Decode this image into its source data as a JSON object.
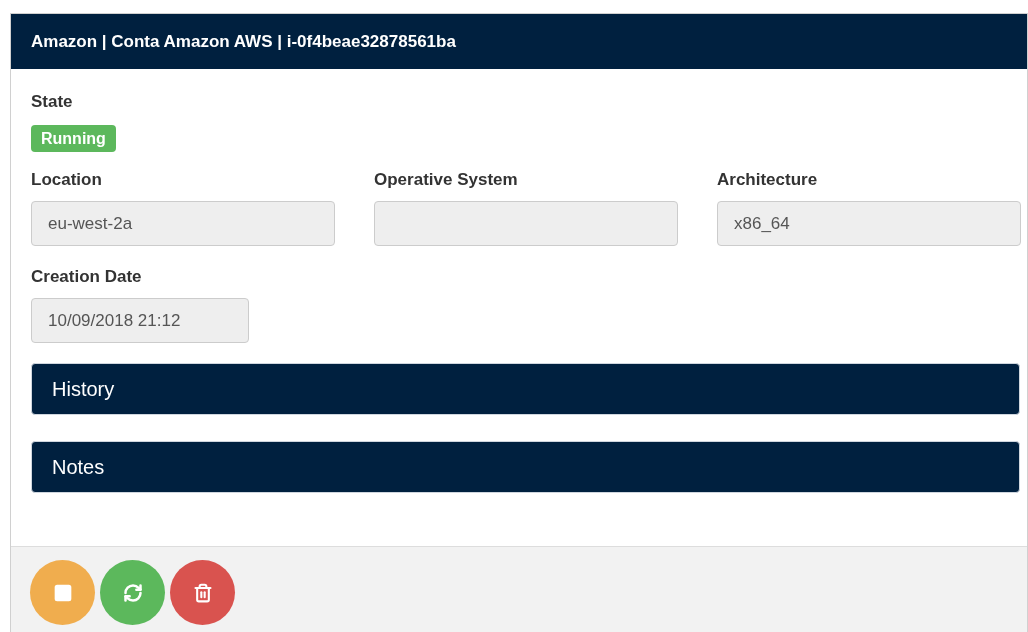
{
  "panel": {
    "title": "Amazon | Conta Amazon AWS | i-0f4beae32878561ba"
  },
  "state": {
    "label": "State",
    "badge": "Running",
    "color": "#5cb85c"
  },
  "fields": [
    {
      "label": "Location",
      "value": "eu-west-2a"
    },
    {
      "label": "Operative System"
    },
    {
      "label": "Architecture",
      "value": "x86_64"
    }
  ],
  "creation": {
    "label": "Creation Date",
    "value": "10/09/2018 21:12"
  },
  "sections": [
    {
      "title": "History"
    },
    {
      "title": "Notes"
    }
  ],
  "actions": [
    {
      "kind": "stop",
      "color": "#f0ad4e"
    },
    {
      "kind": "refresh",
      "color": "#5cb85c"
    },
    {
      "kind": "delete",
      "color": "#d9534f"
    }
  ]
}
